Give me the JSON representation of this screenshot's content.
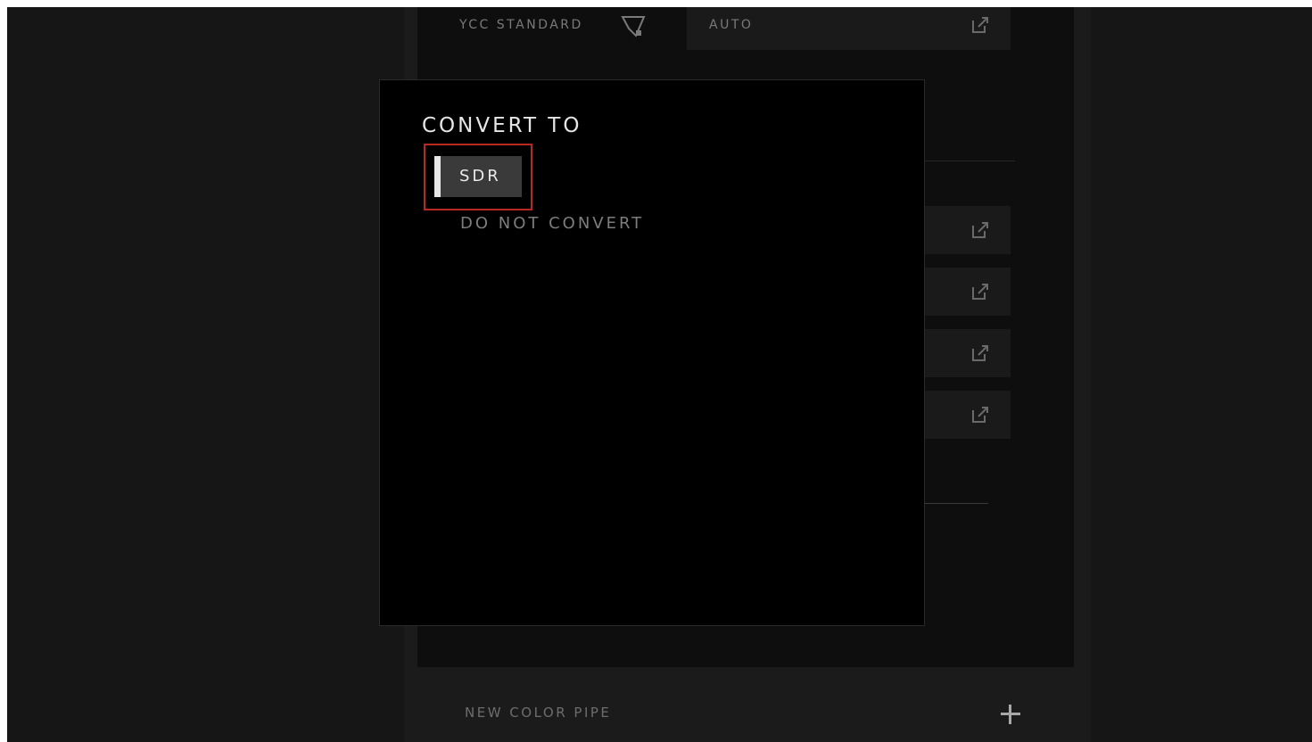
{
  "background_panel": {
    "ycc_label": "YCC STANDARD",
    "ycc_value": "AUTO",
    "new_color_pipe_label": "NEW COLOR PIPE"
  },
  "modal": {
    "title": "CONVERT TO",
    "options": [
      {
        "label": "SDR",
        "selected": true
      },
      {
        "label": "DO NOT CONVERT",
        "selected": false
      }
    ]
  },
  "colors": {
    "accent_highlight": "#b82a1f",
    "modal_bg": "#000000",
    "app_bg": "#161616"
  },
  "icons": [
    "gamut-icon",
    "external-link-icon",
    "plus-icon"
  ]
}
